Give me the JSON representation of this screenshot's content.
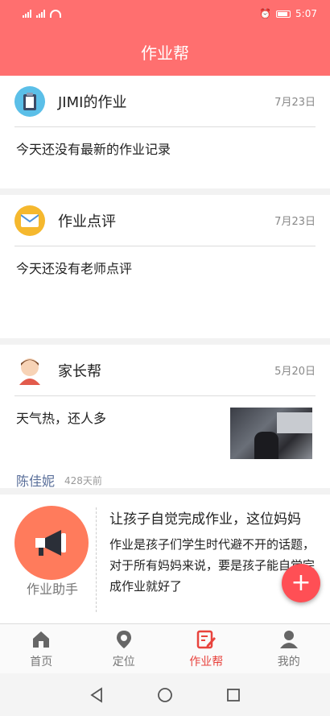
{
  "status_bar": {
    "time": "5:07"
  },
  "header": {
    "title": "作业帮"
  },
  "cards": [
    {
      "title": "JIMI的作业",
      "date": "7月23日",
      "body": "今天还没有最新的作业记录"
    },
    {
      "title": "作业点评",
      "date": "7月23日",
      "body": "今天还没有老师点评"
    },
    {
      "title": "家长帮",
      "date": "5月20日",
      "body": "天气热，还人多",
      "author": "陈佳妮",
      "ago": "428天前"
    }
  ],
  "assistant": {
    "label": "作业助手",
    "headline": "让孩子自觉完成作业，这位妈妈",
    "text": "作业是孩子们学生时代避不开的话题，对于所有妈妈来说，要是孩子能自觉完成作业就好了"
  },
  "fab": {
    "label": "+"
  },
  "tabs": [
    {
      "label": "首页",
      "icon": "home-icon",
      "active": false
    },
    {
      "label": "定位",
      "icon": "location-icon",
      "active": false
    },
    {
      "label": "作业帮",
      "icon": "homework-icon",
      "active": true
    },
    {
      "label": "我的",
      "icon": "profile-icon",
      "active": false
    }
  ],
  "colors": {
    "brand": "#ff6f6f",
    "active_tab": "#e8433d",
    "fab": "#ff4f55",
    "author": "#5a6f9a"
  }
}
